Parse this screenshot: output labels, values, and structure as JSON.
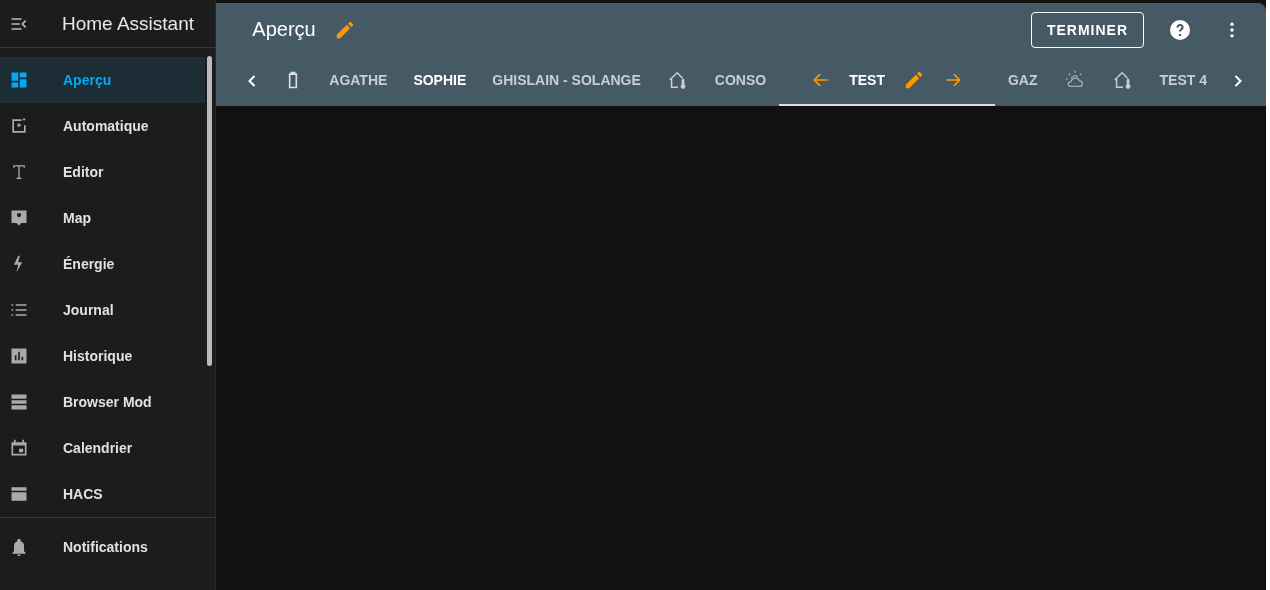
{
  "sidebar": {
    "title": "Home Assistant",
    "items": [
      {
        "label": "Aperçu",
        "selected": true
      },
      {
        "label": "Automatique",
        "selected": false
      },
      {
        "label": "Editor",
        "selected": false
      },
      {
        "label": "Map",
        "selected": false
      },
      {
        "label": "Énergie",
        "selected": false
      },
      {
        "label": "Journal",
        "selected": false
      },
      {
        "label": "Historique",
        "selected": false
      },
      {
        "label": "Browser Mod",
        "selected": false
      },
      {
        "label": "Calendrier",
        "selected": false
      },
      {
        "label": "HACS",
        "selected": false
      }
    ],
    "bottom": [
      {
        "label": "Notifications"
      }
    ]
  },
  "header": {
    "title": "Aperçu",
    "button": "TERMINER"
  },
  "tabs": [
    {
      "kind": "battery",
      "selected": false
    },
    {
      "kind": "text",
      "label": "AGATHE",
      "selected": false,
      "bright": false
    },
    {
      "kind": "text",
      "label": "SOPHIE",
      "selected": false,
      "bright": true
    },
    {
      "kind": "text",
      "label": "GHISLAIN - SOLANGE",
      "selected": false,
      "bright": false
    },
    {
      "kind": "house",
      "selected": false
    },
    {
      "kind": "text",
      "label": "CONSO",
      "selected": false,
      "bright": false
    },
    {
      "kind": "text",
      "label": "TEST",
      "selected": true,
      "bright": true
    },
    {
      "kind": "text",
      "label": "GAZ",
      "selected": false,
      "bright": false
    },
    {
      "kind": "weather",
      "selected": false
    },
    {
      "kind": "house",
      "selected": false
    },
    {
      "kind": "text",
      "label": "TEST 4",
      "selected": false,
      "bright": false
    }
  ]
}
